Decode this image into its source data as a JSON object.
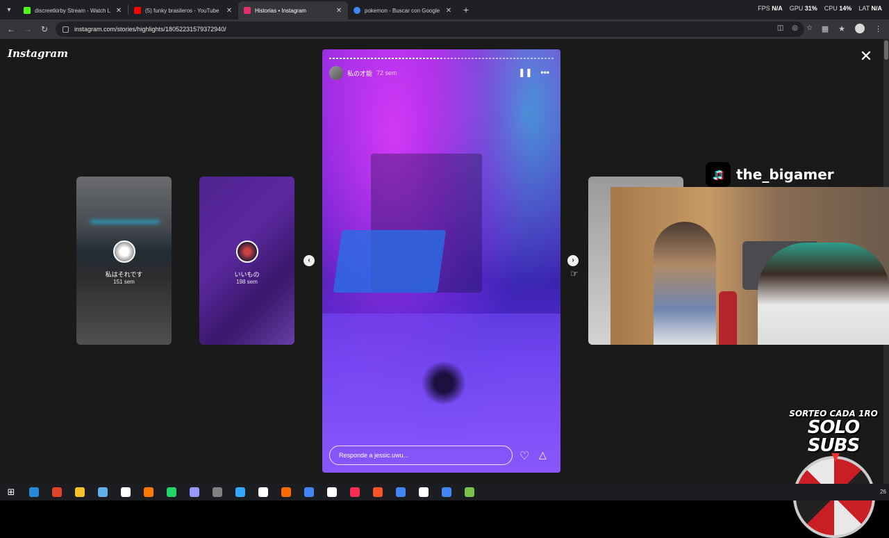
{
  "browser": {
    "tabs": [
      {
        "title": "discreetkirby Stream - Watch L",
        "color": "#53fc18",
        "active": false
      },
      {
        "title": "(5) funky brasileros - YouTube",
        "color": "#ff0000",
        "active": false
      },
      {
        "title": "Historias • Instagram",
        "color": "#e1306c",
        "active": true
      },
      {
        "title": "pokemon - Buscar con Google",
        "color": "#4285f4",
        "active": false
      }
    ],
    "url": "instagram.com/stories/highlights/18052231579372940/",
    "stats": {
      "fps_label": "FPS",
      "fps_value": "N/A",
      "gpu_label": "GPU",
      "gpu_value": "31%",
      "cpu_label": "CPU",
      "cpu_value": "14%",
      "lat_label": "LAT",
      "lat_value": "N/A"
    }
  },
  "instagram": {
    "logo": "Instagram",
    "story": {
      "username": "私の才能",
      "time": "72 sem",
      "reply_placeholder": "Responde a jessic.uwu...",
      "progress": 0.5
    },
    "previews": [
      {
        "name": "私はそれです",
        "time": "151 sem"
      },
      {
        "name": "いいもの",
        "time": "198 sem"
      }
    ]
  },
  "overlay": {
    "tiktok_handle": "the_bigamer",
    "promo_line1": "SORTEO CADA 1RO",
    "promo_line2": "SOLO SUBS"
  },
  "taskbar": {
    "apps": [
      "#2b88d8",
      "#e0452b",
      "#f6c12d",
      "#5fb0e6",
      "#ffffff",
      "#ff7a00",
      "#25d366",
      "#9999ff",
      "#808080",
      "#31a8ff",
      "#ffffff",
      "#ff6a00",
      "#4285f4",
      "#ffffff",
      "#fe2c55",
      "#fb542b",
      "#4285f4",
      "#ffffff",
      "#4285f4",
      "#7cc24a"
    ],
    "clock": "26"
  }
}
